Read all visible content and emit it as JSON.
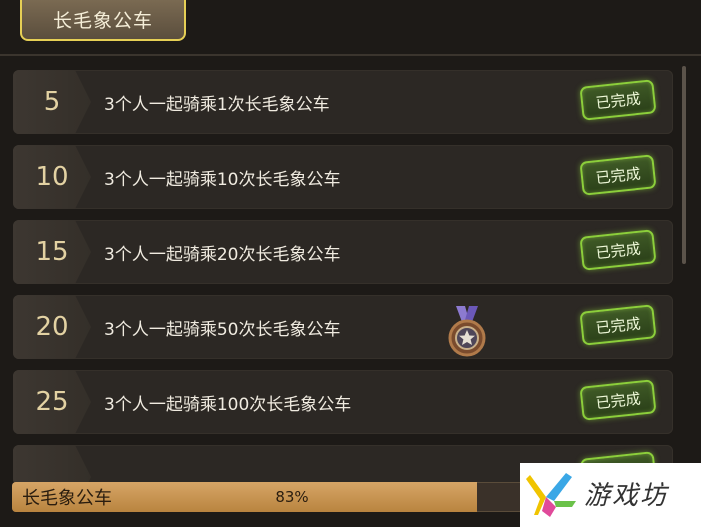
{
  "header": {
    "tab_label": "长毛象公车"
  },
  "rows": [
    {
      "level": "5",
      "task": "3个人一起骑乘1次长毛象公车",
      "status": "已完成"
    },
    {
      "level": "10",
      "task": "3个人一起骑乘10次长毛象公车",
      "status": "已完成"
    },
    {
      "level": "15",
      "task": "3个人一起骑乘20次长毛象公车",
      "status": "已完成"
    },
    {
      "level": "20",
      "task": "3个人一起骑乘50次长毛象公车",
      "status": "已完成"
    },
    {
      "level": "25",
      "task": "3个人一起骑乘100次长毛象公车",
      "status": "已完成"
    }
  ],
  "progress": {
    "label": "长毛象公车",
    "value_text": "83%",
    "fraction": 0.83
  },
  "watermark": {
    "text": "游戏坊"
  },
  "colors": {
    "accent_gold": "#e6cf55",
    "done_green": "#8ccf3b",
    "bar_fill": "#d6a566"
  }
}
